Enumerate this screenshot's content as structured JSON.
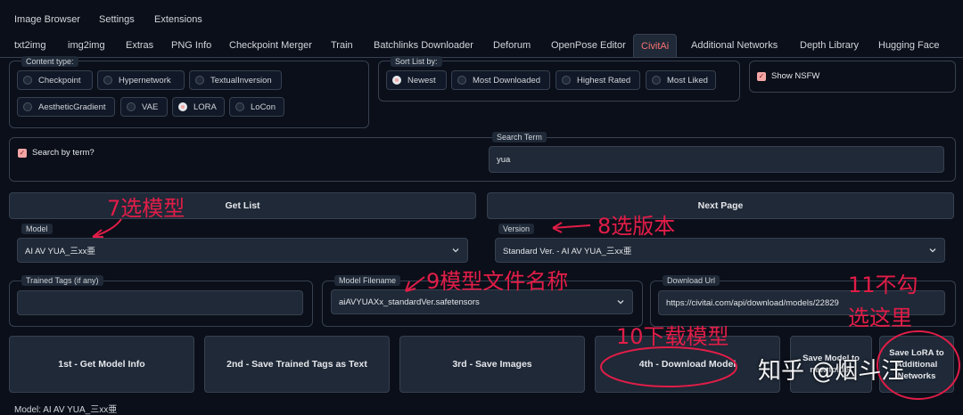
{
  "top_nav": [
    "Image Browser",
    "Settings",
    "Extensions"
  ],
  "tabs": [
    "txt2img",
    "img2img",
    "Extras",
    "PNG Info",
    "Checkpoint Merger",
    "Train",
    "Batchlinks Downloader",
    "Deforum",
    "OpenPose Editor",
    "CivitAi",
    "Additional Networks",
    "Depth Library",
    "Hugging Face"
  ],
  "active_tab": "CivitAi",
  "content_type": {
    "label": "Content type:",
    "options": [
      "Checkpoint",
      "Hypernetwork",
      "TextualInversion",
      "AestheticGradient",
      "VAE",
      "LORA",
      "LoCon"
    ],
    "selected": "LORA"
  },
  "sort": {
    "label": "Sort List by:",
    "options": [
      "Newest",
      "Most Downloaded",
      "Highest Rated",
      "Most Liked"
    ],
    "selected": "Newest"
  },
  "show_nsfw": {
    "label": "Show NSFW",
    "checked": true
  },
  "search_by_term": {
    "label": "Search by term?",
    "checked": true
  },
  "search_term": {
    "label": "Search Term",
    "value": "yua"
  },
  "buttons": {
    "get_list": "Get List",
    "next_page": "Next Page",
    "get_model_info": "1st - Get Model Info",
    "save_tags": "2nd - Save Trained Tags as Text",
    "save_images": "3rd - Save Images",
    "download_model": "4th - Download Model",
    "save_model_new_folder": "Save Model to new folder",
    "save_lora_additional": "Save LoRA to Additional Networks"
  },
  "model": {
    "label": "Model",
    "value": "AI AV YUA_三xx亜"
  },
  "version": {
    "label": "Version",
    "value": "Standard Ver. - AI AV YUA_三xx亜"
  },
  "trained_tags": {
    "label": "Trained Tags (if any)",
    "value": ""
  },
  "model_filename": {
    "label": "Model Filename",
    "value": "aiAVYUAXx_standardVer.safetensors"
  },
  "download_url": {
    "label": "Download Url",
    "value": "https://civitai.com/api/download/models/22829"
  },
  "bottom_text": "Model: AI AV YUA_三xx亜",
  "annotations": {
    "a7": "7选模型",
    "a8": "8选版本",
    "a9": "9模型文件名称",
    "a10": "10下载模型",
    "a11_line1": "11不勾",
    "a11_line2": "选这里"
  },
  "watermark": "知乎 @烟斗汪",
  "colors": {
    "background": "#0b0f19",
    "panel": "#1f2937",
    "accent": "#f4a6a6",
    "annotation": "#e11d48"
  }
}
